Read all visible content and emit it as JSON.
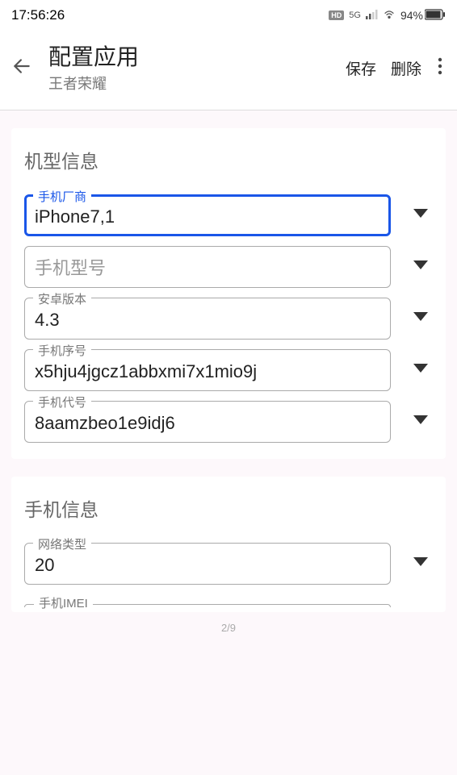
{
  "status_bar": {
    "time": "17:56:26",
    "hd_badge": "HD",
    "network_type": "5G",
    "battery_pct": "94%"
  },
  "header": {
    "title": "配置应用",
    "subtitle": "王者荣耀",
    "save": "保存",
    "delete": "删除"
  },
  "sections": {
    "device_info": {
      "heading": "机型信息",
      "fields": {
        "manufacturer": {
          "label": "手机厂商",
          "value": "iPhone7,1"
        },
        "model": {
          "label": "",
          "placeholder": "手机型号",
          "value": ""
        },
        "android_version": {
          "label": "安卓版本",
          "value": "4.3"
        },
        "serial": {
          "label": "手机序号",
          "value": "x5hju4jgcz1abbxmi7x1mio9j"
        },
        "codename": {
          "label": "手机代号",
          "value": "8aamzbeo1e9idj6"
        }
      }
    },
    "phone_info": {
      "heading": "手机信息",
      "fields": {
        "network_type": {
          "label": "网络类型",
          "value": "20"
        },
        "imei": {
          "label": "手机IMEI",
          "value": ""
        }
      }
    }
  },
  "page_indicator": "2/9"
}
